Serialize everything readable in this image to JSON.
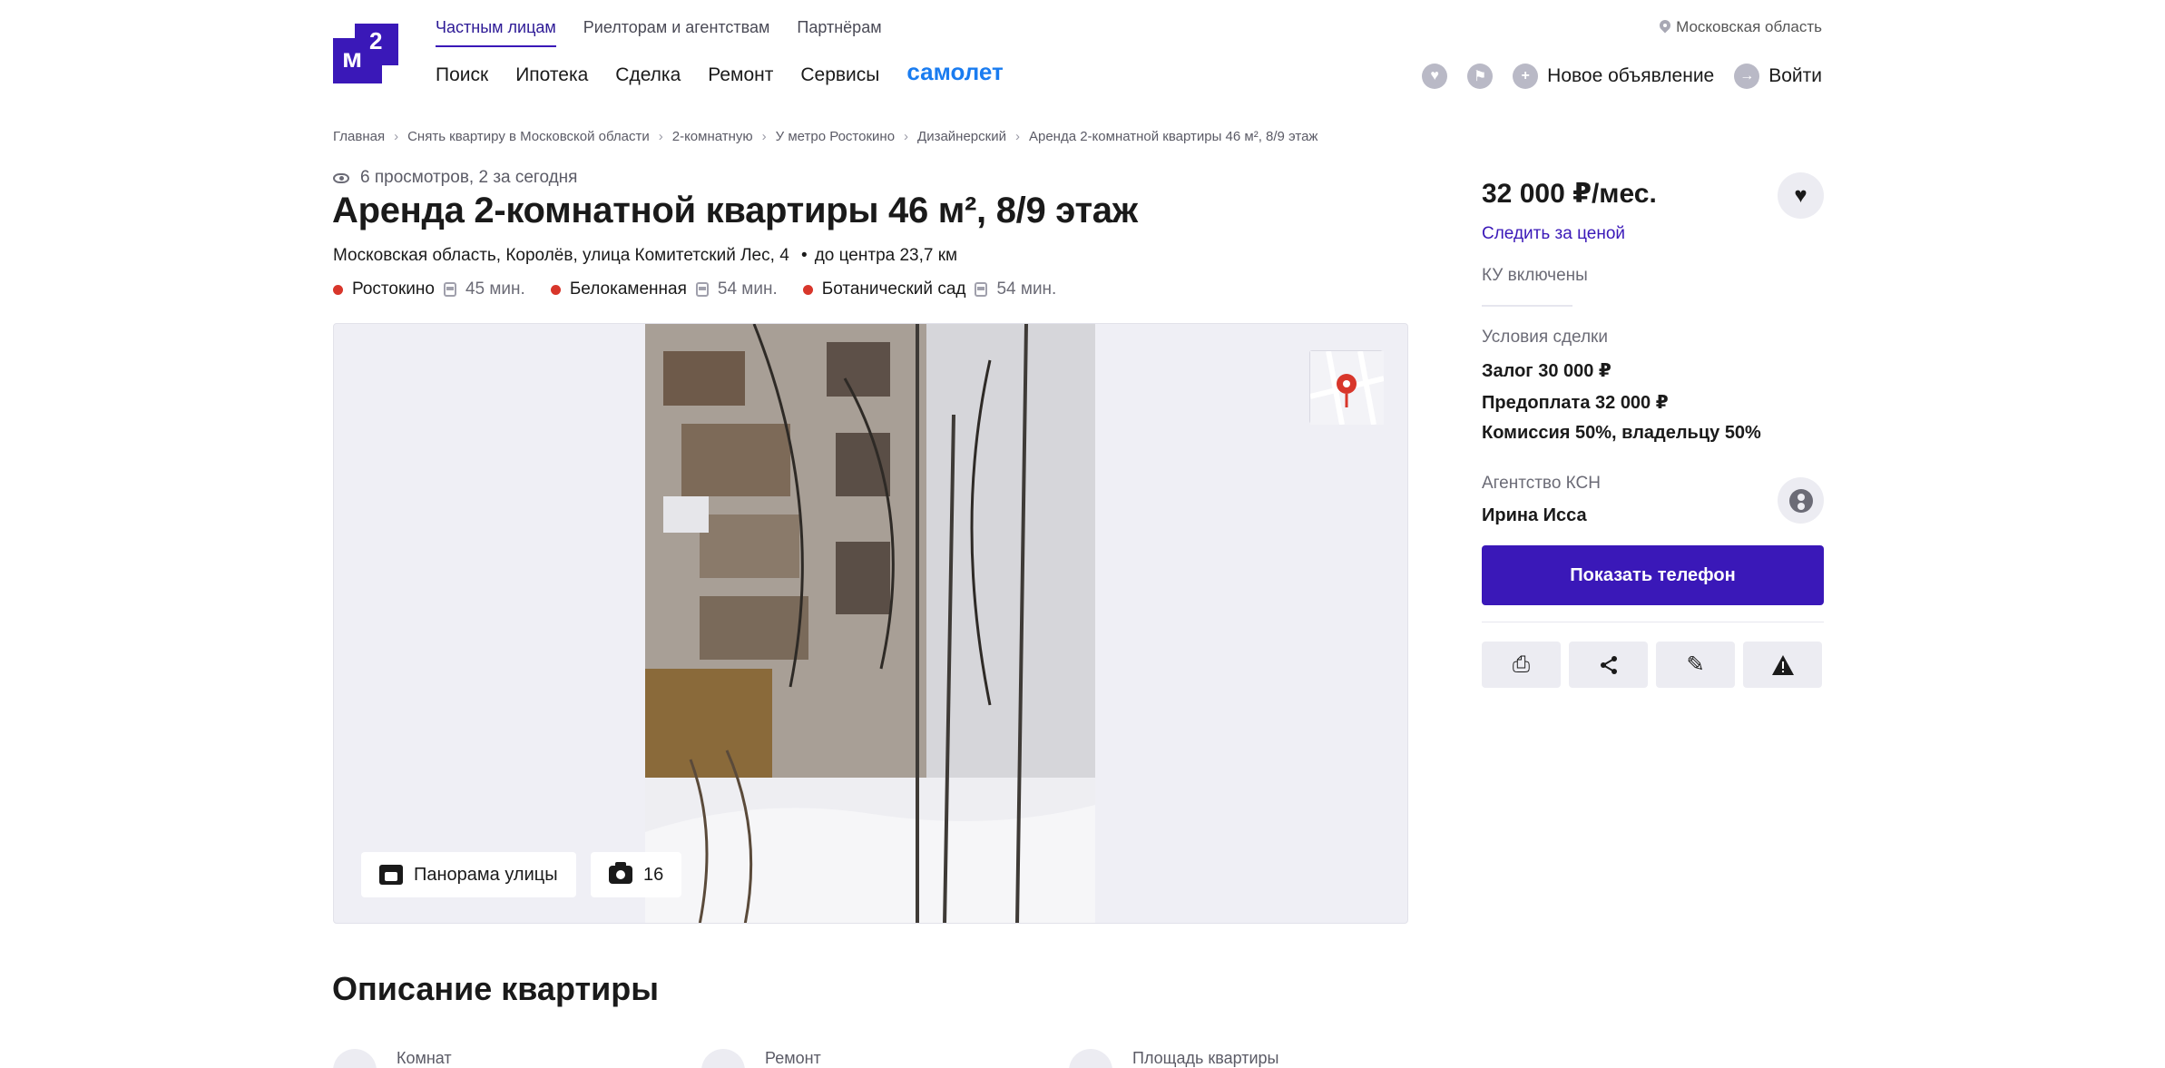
{
  "header": {
    "tabs": [
      "Частным лицам",
      "Риелторам и агентствам",
      "Партнёрам"
    ],
    "nav": [
      "Поиск",
      "Ипотека",
      "Сделка",
      "Ремонт",
      "Сервисы"
    ],
    "promo": "самолет",
    "region": "Московская область",
    "new_ad": "Новое объявление",
    "login": "Войти",
    "logo_text": "м",
    "logo_sup": "2"
  },
  "breadcrumb": [
    "Главная",
    "Снять квартиру в Московской области",
    "2-комнатную",
    "У метро Ростокино",
    "Дизайнерский",
    "Аренда 2-комнатной квартиры 46 м², 8/9 этаж"
  ],
  "listing": {
    "views": "6 просмотров, 2 за сегодня",
    "title": "Аренда 2-комнатной квартиры 46 м², 8/9 этаж",
    "address": [
      "Московская область,",
      "Королёв,",
      "улица Комитетский Лес,",
      "4"
    ],
    "distance": "до центра 23,7 км",
    "metro": [
      {
        "name": "Ростокино",
        "time": "45 мин."
      },
      {
        "name": "Белокаменная",
        "time": "54 мин."
      },
      {
        "name": "Ботанический сад",
        "time": "54 мин."
      }
    ],
    "panorama_label": "Панорама улицы",
    "photo_count": "16"
  },
  "sidebar": {
    "price": "32 000 ₽/мес.",
    "follow_price": "Следить за ценой",
    "utilities": "КУ включены",
    "deal_label": "Условия сделки",
    "deposit": "Залог 30 000 ₽",
    "prepayment": "Предоплата 32 000 ₽",
    "commission": "Комиссия 50%, владельцу 50%",
    "agency": "Агентство КСН",
    "agent": "Ирина Исса",
    "show_phone": "Показать телефон"
  },
  "description": {
    "title": "Описание квартиры",
    "features": [
      "Комнат",
      "Ремонт",
      "Площадь квартиры"
    ]
  },
  "colors": {
    "brand": "#3a18b8",
    "metro_dot": "#d8362b",
    "promo": "#1a7cf0"
  }
}
